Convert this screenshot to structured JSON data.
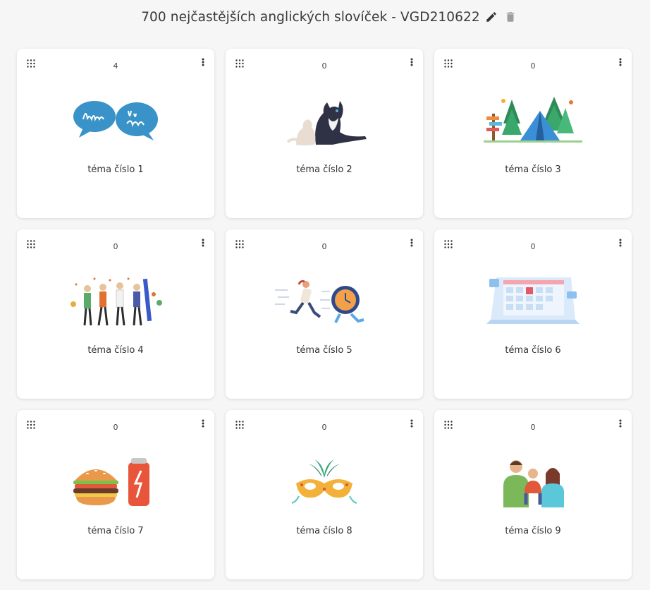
{
  "header": {
    "title": "700 nejčastějších anglických slovíček - VGD210622",
    "edit_icon": "pencil-icon",
    "delete_icon": "trash-icon"
  },
  "cards": [
    {
      "count": "4",
      "label": "téma číslo 1",
      "image": "hello-hi-there-speech-bubbles"
    },
    {
      "count": "0",
      "label": "téma číslo 2",
      "image": "dog-and-cat"
    },
    {
      "count": "0",
      "label": "téma číslo 3",
      "image": "camping-tent-in-forest"
    },
    {
      "count": "0",
      "label": "téma číslo 4",
      "image": "party-people-celebrating"
    },
    {
      "count": "0",
      "label": "téma číslo 5",
      "image": "person-running-from-clock"
    },
    {
      "count": "0",
      "label": "téma číslo 6",
      "image": "desk-calendar"
    },
    {
      "count": "0",
      "label": "téma číslo 7",
      "image": "burger-and-soda-can"
    },
    {
      "count": "0",
      "label": "téma číslo 8",
      "image": "carnival-mask"
    },
    {
      "count": "0",
      "label": "téma číslo 9",
      "image": "family-parents-and-child"
    }
  ]
}
